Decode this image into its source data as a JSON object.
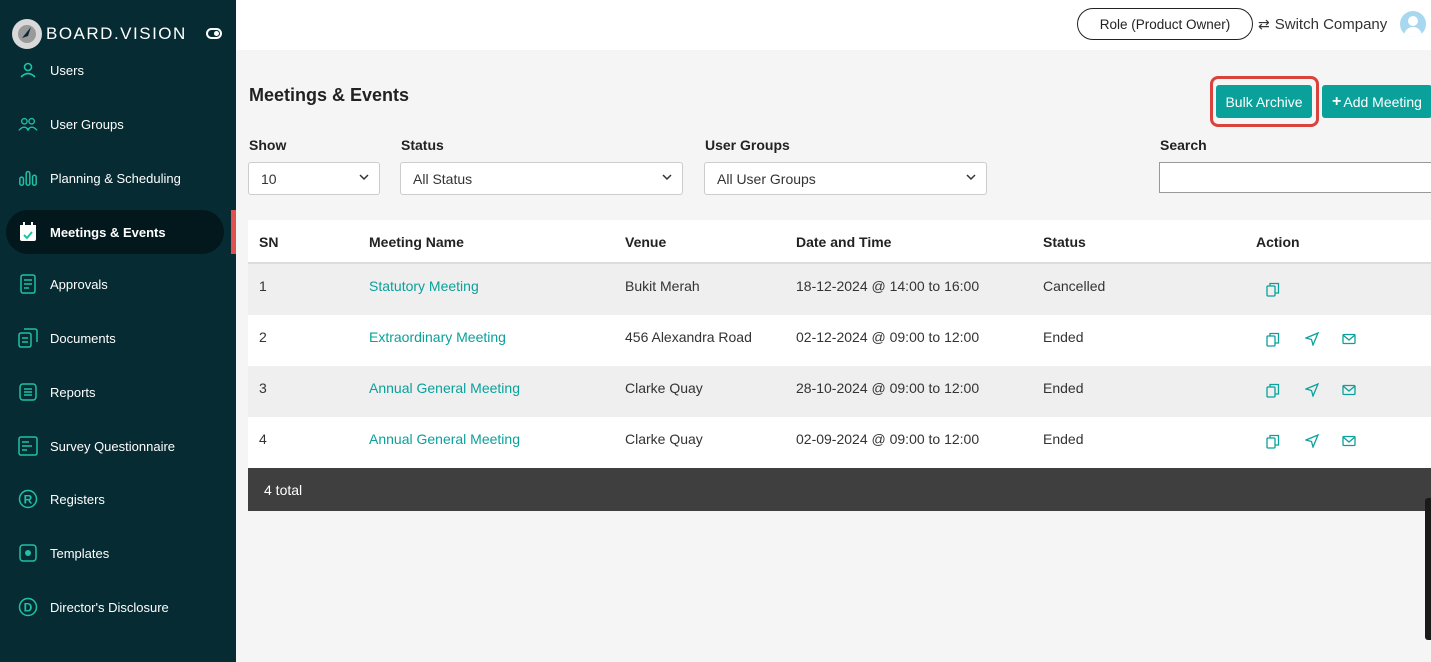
{
  "brand": {
    "name": "BOARD.VISION"
  },
  "sidebar": {
    "items": [
      {
        "label": "Users",
        "icon": "user-icon"
      },
      {
        "label": "User Groups",
        "icon": "users-icon"
      },
      {
        "label": "Planning & Scheduling",
        "icon": "bar-chart-icon"
      },
      {
        "label": "Meetings & Events",
        "icon": "calendar-check-icon",
        "active": true
      },
      {
        "label": "Approvals",
        "icon": "document-check-icon"
      },
      {
        "label": "Documents",
        "icon": "documents-icon"
      },
      {
        "label": "Reports",
        "icon": "list-icon"
      },
      {
        "label": "Survey Questionnaire",
        "icon": "survey-icon"
      },
      {
        "label": "Registers",
        "icon": "registered-icon"
      },
      {
        "label": "Templates",
        "icon": "template-icon"
      },
      {
        "label": "Director's Disclosure",
        "icon": "d-circle-icon"
      }
    ]
  },
  "topbar": {
    "role_label": "Role (Product Owner)",
    "switch_company_label": "Switch Company"
  },
  "main": {
    "title": "Meetings & Events",
    "bulk_archive_label": "Bulk Archive",
    "add_meeting_label": "Add Meeting"
  },
  "filters": {
    "show": {
      "label": "Show",
      "value": "10"
    },
    "status": {
      "label": "Status",
      "value": "All Status"
    },
    "user_groups": {
      "label": "User Groups",
      "value": "All User Groups"
    },
    "search": {
      "label": "Search",
      "value": ""
    }
  },
  "table": {
    "columns": [
      "SN",
      "Meeting Name",
      "Venue",
      "Date and Time",
      "Status",
      "Action"
    ],
    "rows": [
      {
        "sn": "1",
        "name": "Statutory Meeting",
        "venue": "Bukit Merah",
        "datetime": "18-12-2024 @ 14:00 to 16:00",
        "status": "Cancelled",
        "actions": [
          "copy-icon"
        ]
      },
      {
        "sn": "2",
        "name": "Extraordinary Meeting",
        "venue": "456 Alexandra Road",
        "datetime": "02-12-2024 @ 09:00 to 12:00",
        "status": "Ended",
        "actions": [
          "copy-icon",
          "send-icon",
          "mail-icon"
        ]
      },
      {
        "sn": "3",
        "name": "Annual General Meeting",
        "venue": "Clarke Quay",
        "datetime": "28-10-2024 @ 09:00 to 12:00",
        "status": "Ended",
        "actions": [
          "copy-icon",
          "send-icon",
          "mail-icon"
        ]
      },
      {
        "sn": "4",
        "name": "Annual General Meeting",
        "venue": "Clarke Quay",
        "datetime": "02-09-2024 @ 09:00 to 12:00",
        "status": "Ended",
        "actions": [
          "copy-icon",
          "send-icon",
          "mail-icon"
        ]
      }
    ],
    "footer": "4 total"
  },
  "colors": {
    "sidebar_bg": "#062b33",
    "accent": "#0aa19a",
    "highlight": "#d9433c"
  }
}
